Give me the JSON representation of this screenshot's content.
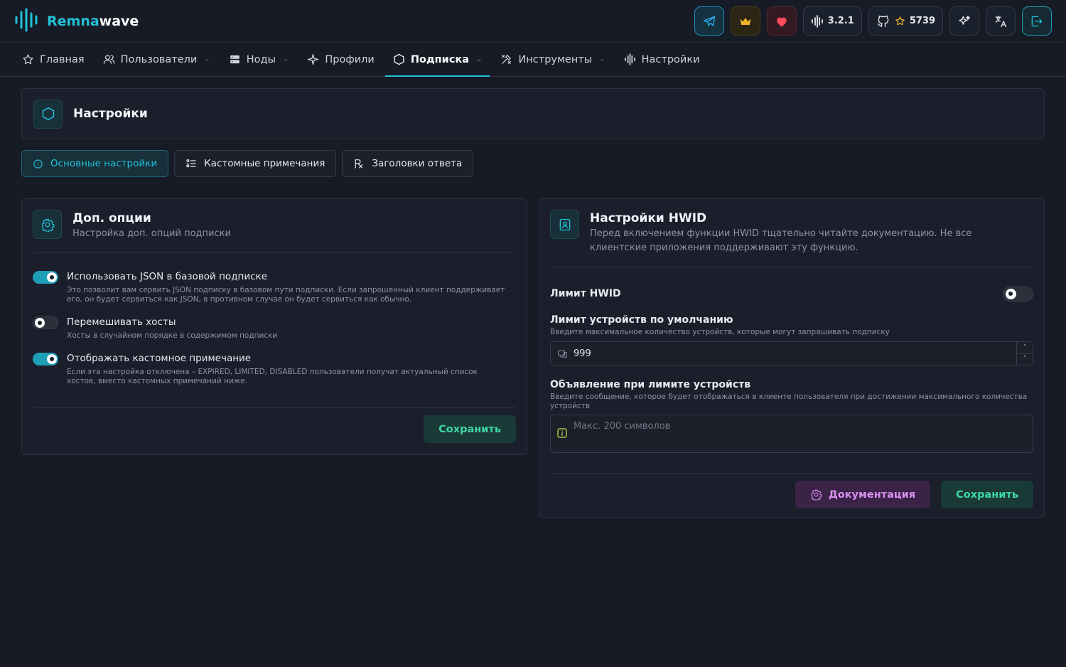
{
  "app": {
    "brand_part1": "Remna",
    "brand_part2": "wave"
  },
  "header": {
    "version": "3.2.1",
    "github_stars": "5739"
  },
  "nav": {
    "items": [
      {
        "label": "Главная",
        "dropdown": false
      },
      {
        "label": "Пользователи",
        "dropdown": true
      },
      {
        "label": "Ноды",
        "dropdown": true
      },
      {
        "label": "Профили",
        "dropdown": false
      },
      {
        "label": "Подписка",
        "dropdown": true,
        "active": true
      },
      {
        "label": "Инструменты",
        "dropdown": true
      },
      {
        "label": "Настройки",
        "dropdown": false
      }
    ]
  },
  "page": {
    "title": "Настройки"
  },
  "tabs": [
    {
      "label": "Основные настройки",
      "active": true
    },
    {
      "label": "Кастомные примечания"
    },
    {
      "label": "Заголовки ответа"
    }
  ],
  "left_card": {
    "title": "Доп. опции",
    "subtitle": "Настройка доп. опций подписки",
    "options": [
      {
        "label": "Использовать JSON в базовой подписке",
        "desc": "Это позволит вам сервить JSON подписку в базовом пути подписки. Если запрошенный клиент поддерживает его, он будет сервиться как JSON, в противном случае он будет сервиться как обычно.",
        "enabled": true
      },
      {
        "label": "Перемешивать хосты",
        "desc": "Хосты в случайном порядке в содержимом подписки",
        "enabled": false
      },
      {
        "label": "Отображать кастомное примечание",
        "desc": "Если эта настройка отключена – EXPIRED, LIMITED, DISABLED пользователи получат актуальный список хостов, вместо кастомных примечаний ниже.",
        "enabled": true
      }
    ],
    "save_label": "Сохранить"
  },
  "right_card": {
    "title": "Настройки HWID",
    "subtitle": "Перед включением функции HWID тщательно читайте документацию. Не все клиентские приложения поддерживают эту функцию.",
    "hwid_limit_label": "Лимит HWID",
    "hwid_limit_enabled": false,
    "device_limit_label": "Лимит устройств по умолчанию",
    "device_limit_desc": "Введите максимальное количество устройств, которые могут запрашивать подписку",
    "device_limit_value": "999",
    "announce_label": "Объявление при лимите устройств",
    "announce_desc": "Введите сообщение, которое будет отображаться в клиенте пользователя при достижении максимального количества устройств",
    "announce_placeholder": "Макс. 200 символов",
    "docs_label": "Документация",
    "save_label": "Сохранить"
  },
  "colors": {
    "accent": "#22c1d9",
    "save_text": "#3fd6a6",
    "docs_text": "#d88ef0",
    "background": "#161b26"
  }
}
